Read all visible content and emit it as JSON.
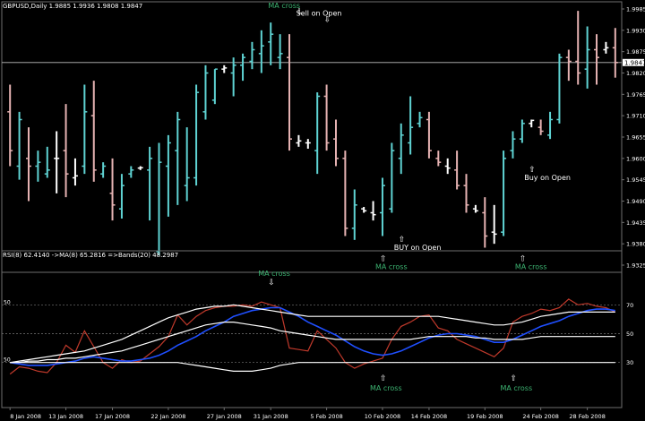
{
  "colors": {
    "background": "#000000",
    "bull": "#5fd3d3",
    "bear": "#e6b3b3",
    "doji": "#ffffff",
    "grid": "#6e6e6e",
    "text": "#ffffff",
    "annotation_green": "#3cb371",
    "rsi_line": "#c0392b",
    "ma_line": "#1f4fff",
    "band_line": "#ffffff",
    "level_line": "#777777"
  },
  "main_header": "GBPUSD,Daily  1.9885 1.9936 1.9808 1.9847",
  "rsi_header": "RSI(8) 62.4140  ->MA(8) 65.2816  =>Bands(20) 48.2987",
  "current_price_label": "1.9847",
  "chart_data": [
    {
      "type": "ohlc",
      "title": "GBPUSD,Daily",
      "price_ticks": [
        "1.9985",
        "1.9930",
        "1.9875",
        "1.9820",
        "1.9765",
        "1.9710",
        "1.9655",
        "1.9600",
        "1.9545",
        "1.9490",
        "1.9435",
        "1.9380",
        "1.9325"
      ],
      "ylim": [
        1.9325,
        1.9985
      ],
      "current_price": 1.9847,
      "date_ticks": [
        "8 Jan 2008",
        "13 Jan 2008",
        "17 Jan 2008",
        "22 Jan 2008",
        "27 Jan 2008",
        "31 Jan 2008",
        "5 Feb 2008",
        "10 Feb 2008",
        "14 Feb 2008",
        "19 Feb 2008",
        "24 Feb 2008",
        "28 Feb 2008"
      ],
      "bars": [
        {
          "o": 1.972,
          "h": 1.979,
          "l": 1.958,
          "c": 1.962
        },
        {
          "o": 1.958,
          "h": 1.972,
          "l": 1.9545,
          "c": 1.97
        },
        {
          "o": 1.96,
          "h": 1.968,
          "l": 1.949,
          "c": 1.958
        },
        {
          "o": 1.958,
          "h": 1.962,
          "l": 1.954,
          "c": 1.959
        },
        {
          "o": 1.956,
          "h": 1.963,
          "l": 1.955,
          "c": 1.957
        },
        {
          "o": 1.96,
          "h": 1.967,
          "l": 1.951,
          "c": 1.96
        },
        {
          "o": 1.962,
          "h": 1.974,
          "l": 1.95,
          "c": 1.956
        },
        {
          "o": 1.955,
          "h": 1.96,
          "l": 1.953,
          "c": 1.9555
        },
        {
          "o": 1.958,
          "h": 1.979,
          "l": 1.956,
          "c": 1.972
        },
        {
          "o": 1.971,
          "h": 1.98,
          "l": 1.954,
          "c": 1.957
        },
        {
          "o": 1.956,
          "h": 1.959,
          "l": 1.955,
          "c": 1.958
        },
        {
          "o": 1.951,
          "h": 1.96,
          "l": 1.944,
          "c": 1.948
        },
        {
          "o": 1.947,
          "h": 1.956,
          "l": 1.9445,
          "c": 1.953
        },
        {
          "o": 1.956,
          "h": 1.958,
          "l": 1.955,
          "c": 1.957
        },
        {
          "o": 1.9575,
          "h": 1.958,
          "l": 1.957,
          "c": 1.9576
        },
        {
          "o": 1.957,
          "h": 1.963,
          "l": 1.944,
          "c": 1.96
        },
        {
          "o": 1.936,
          "h": 1.964,
          "l": 1.935,
          "c": 1.959
        },
        {
          "o": 1.958,
          "h": 1.966,
          "l": 1.945,
          "c": 1.964
        },
        {
          "o": 1.962,
          "h": 1.972,
          "l": 1.948,
          "c": 1.97
        },
        {
          "o": 1.953,
          "h": 1.968,
          "l": 1.949,
          "c": 1.955
        },
        {
          "o": 1.955,
          "h": 1.979,
          "l": 1.953,
          "c": 1.977
        },
        {
          "o": 1.972,
          "h": 1.984,
          "l": 1.97,
          "c": 1.982
        },
        {
          "o": 1.975,
          "h": 1.983,
          "l": 1.974,
          "c": 1.983
        },
        {
          "o": 1.983,
          "h": 1.984,
          "l": 1.982,
          "c": 1.9833
        },
        {
          "o": 1.982,
          "h": 1.986,
          "l": 1.976,
          "c": 1.984
        },
        {
          "o": 1.984,
          "h": 1.987,
          "l": 1.98,
          "c": 1.986
        },
        {
          "o": 1.985,
          "h": 1.99,
          "l": 1.983,
          "c": 1.988
        },
        {
          "o": 1.987,
          "h": 1.993,
          "l": 1.982,
          "c": 1.989
        },
        {
          "o": 1.99,
          "h": 1.995,
          "l": 1.984,
          "c": 1.992
        },
        {
          "o": 1.986,
          "h": 1.992,
          "l": 1.983,
          "c": 1.987
        },
        {
          "o": 1.986,
          "h": 1.992,
          "l": 1.962,
          "c": 1.965
        },
        {
          "o": 1.964,
          "h": 1.966,
          "l": 1.963,
          "c": 1.9645
        },
        {
          "o": 1.964,
          "h": 1.965,
          "l": 1.9625,
          "c": 1.964
        },
        {
          "o": 1.962,
          "h": 1.977,
          "l": 1.956,
          "c": 1.976
        },
        {
          "o": 1.976,
          "h": 1.979,
          "l": 1.962,
          "c": 1.964
        },
        {
          "o": 1.965,
          "h": 1.97,
          "l": 1.958,
          "c": 1.96
        },
        {
          "o": 1.96,
          "h": 1.962,
          "l": 1.94,
          "c": 1.942
        },
        {
          "o": 1.942,
          "h": 1.952,
          "l": 1.939,
          "c": 1.948
        },
        {
          "o": 1.947,
          "h": 1.9475,
          "l": 1.946,
          "c": 1.9465
        },
        {
          "o": 1.946,
          "h": 1.949,
          "l": 1.944,
          "c": 1.9455
        },
        {
          "o": 1.946,
          "h": 1.955,
          "l": 1.94,
          "c": 1.953
        },
        {
          "o": 1.947,
          "h": 1.964,
          "l": 1.946,
          "c": 1.962
        },
        {
          "o": 1.96,
          "h": 1.969,
          "l": 1.956,
          "c": 1.966
        },
        {
          "o": 1.964,
          "h": 1.976,
          "l": 1.961,
          "c": 1.968
        },
        {
          "o": 1.969,
          "h": 1.972,
          "l": 1.968,
          "c": 1.9705
        },
        {
          "o": 1.97,
          "h": 1.972,
          "l": 1.96,
          "c": 1.962
        },
        {
          "o": 1.96,
          "h": 1.962,
          "l": 1.958,
          "c": 1.959
        },
        {
          "o": 1.958,
          "h": 1.96,
          "l": 1.956,
          "c": 1.9575
        },
        {
          "o": 1.957,
          "h": 1.962,
          "l": 1.952,
          "c": 1.953
        },
        {
          "o": 1.953,
          "h": 1.956,
          "l": 1.946,
          "c": 1.948
        },
        {
          "o": 1.947,
          "h": 1.948,
          "l": 1.946,
          "c": 1.9465
        },
        {
          "o": 1.946,
          "h": 1.95,
          "l": 1.937,
          "c": 1.94
        },
        {
          "o": 1.941,
          "h": 1.948,
          "l": 1.938,
          "c": 1.9405
        },
        {
          "o": 1.941,
          "h": 1.962,
          "l": 1.94,
          "c": 1.96
        },
        {
          "o": 1.962,
          "h": 1.967,
          "l": 1.96,
          "c": 1.965
        },
        {
          "o": 1.965,
          "h": 1.97,
          "l": 1.964,
          "c": 1.969
        },
        {
          "o": 1.969,
          "h": 1.97,
          "l": 1.968,
          "c": 1.9698
        },
        {
          "o": 1.968,
          "h": 1.97,
          "l": 1.966,
          "c": 1.967
        },
        {
          "o": 1.966,
          "h": 1.972,
          "l": 1.965,
          "c": 1.97
        },
        {
          "o": 1.97,
          "h": 1.987,
          "l": 1.969,
          "c": 1.986
        },
        {
          "o": 1.986,
          "h": 1.988,
          "l": 1.98,
          "c": 1.985
        },
        {
          "o": 1.985,
          "h": 1.998,
          "l": 1.979,
          "c": 1.982
        },
        {
          "o": 1.983,
          "h": 1.994,
          "l": 1.978,
          "c": 1.988
        },
        {
          "o": 1.988,
          "h": 1.992,
          "l": 1.979,
          "c": 1.986
        },
        {
          "o": 1.988,
          "h": 1.99,
          "l": 1.987,
          "c": 1.9885
        },
        {
          "o": 1.9885,
          "h": 1.9936,
          "l": 1.9808,
          "c": 1.9847
        }
      ],
      "annotations": [
        {
          "text": "MA cross",
          "color": "green",
          "price": 1.9985,
          "bar": 31,
          "arrow": "down"
        },
        {
          "text": "Sell on Open",
          "color": "white",
          "price": 1.9965,
          "bar": 34,
          "arrow": "down"
        },
        {
          "text": "BUY on Open",
          "color": "white",
          "price": 1.939,
          "bar": 42,
          "arrow": "up"
        },
        {
          "text": "MA cross",
          "color": "green",
          "price": 1.934,
          "bar": 40,
          "arrow": "up"
        },
        {
          "text": "Buy on Open",
          "color": "white",
          "price": 1.957,
          "bar": 56,
          "arrow": "up"
        },
        {
          "text": "MA cross",
          "color": "green",
          "price": 1.934,
          "bar": 55,
          "arrow": "up"
        }
      ]
    },
    {
      "type": "line",
      "title": "RSI(8) 62.4140  ->MA(8) 65.2816  =>Bands(20) 48.2987",
      "ylim": [
        0,
        100
      ],
      "levels": [
        70,
        50,
        30
      ],
      "level_labels": [
        "70",
        "50",
        "30"
      ],
      "left_level_labels": [
        "50",
        "50"
      ],
      "series": [
        {
          "name": "RSI(8)",
          "color": "rsi",
          "values": [
            22,
            27,
            26,
            24,
            23,
            30,
            42,
            37,
            52,
            41,
            30,
            26,
            32,
            30,
            31,
            36,
            41,
            48,
            63,
            56,
            62,
            66,
            68,
            69,
            69,
            70,
            69,
            72,
            70,
            68,
            40,
            39,
            38,
            52,
            46,
            40,
            30,
            26,
            29,
            31,
            33,
            46,
            55,
            58,
            62,
            63,
            54,
            52,
            46,
            43,
            40,
            37,
            34,
            40,
            58,
            62,
            64,
            67,
            66,
            68,
            74,
            70,
            71,
            69,
            68,
            65
          ]
        },
        {
          "name": "MA(8)",
          "color": "ma",
          "values": [
            30,
            29,
            28,
            28,
            28,
            29,
            30,
            31,
            33,
            34,
            33,
            32,
            31,
            31,
            32,
            33,
            35,
            38,
            42,
            45,
            48,
            52,
            55,
            58,
            62,
            64,
            66,
            67,
            68,
            68,
            65,
            62,
            58,
            55,
            52,
            49,
            45,
            41,
            38,
            36,
            35,
            36,
            38,
            41,
            44,
            47,
            49,
            50,
            50,
            49,
            48,
            46,
            44,
            44,
            46,
            49,
            52,
            55,
            57,
            59,
            62,
            64,
            66,
            67,
            67,
            66
          ]
        },
        {
          "name": "Bands upper",
          "color": "band",
          "values": [
            30,
            31,
            32,
            33,
            34,
            35,
            36,
            37,
            38,
            40,
            42,
            44,
            46,
            49,
            52,
            55,
            58,
            61,
            63,
            65,
            67,
            68,
            69,
            69,
            70,
            69,
            68,
            67,
            66,
            65,
            64,
            63,
            62,
            62,
            62,
            62,
            62,
            62,
            62,
            62,
            62,
            62,
            62,
            62,
            62,
            62,
            62,
            61,
            60,
            59,
            58,
            57,
            56,
            56,
            57,
            58,
            60,
            62,
            63,
            64,
            65,
            65,
            65,
            65,
            65,
            65
          ]
        },
        {
          "name": "Bands middle",
          "color": "band",
          "values": [
            30,
            30,
            31,
            31,
            32,
            32,
            33,
            33,
            34,
            35,
            36,
            37,
            38,
            40,
            42,
            44,
            46,
            48,
            50,
            52,
            54,
            56,
            57,
            58,
            58,
            57,
            56,
            55,
            54,
            52,
            51,
            50,
            49,
            48,
            47,
            46,
            46,
            46,
            46,
            46,
            46,
            46,
            46,
            46,
            47,
            48,
            48,
            48,
            48,
            48,
            47,
            47,
            46,
            46,
            46,
            46,
            47,
            48,
            48,
            48,
            48,
            48,
            48,
            48,
            48,
            48
          ]
        },
        {
          "name": "Bands lower",
          "color": "band",
          "values": [
            30,
            30,
            30,
            30,
            30,
            30,
            30,
            30,
            30,
            30,
            30,
            30,
            30,
            30,
            30,
            30,
            30,
            30,
            30,
            29,
            28,
            27,
            26,
            25,
            24,
            24,
            24,
            25,
            26,
            28,
            29,
            30,
            30,
            30,
            30,
            30,
            30,
            30,
            30,
            30,
            30,
            30,
            30,
            30,
            30,
            30,
            30,
            30,
            30,
            30,
            30,
            30,
            30,
            30,
            30,
            30,
            30,
            30,
            30,
            30,
            30,
            30,
            30,
            30,
            30,
            30
          ]
        }
      ],
      "annotations": [
        {
          "text": "MA cross",
          "color": "green",
          "value": 98,
          "bar": 28,
          "arrow": "down"
        },
        {
          "text": "MA cross",
          "color": "green",
          "value": 2,
          "bar": 40,
          "arrow": "up"
        },
        {
          "text": "MA cross",
          "color": "green",
          "value": 10,
          "bar": 54,
          "arrow": "up"
        }
      ]
    }
  ]
}
